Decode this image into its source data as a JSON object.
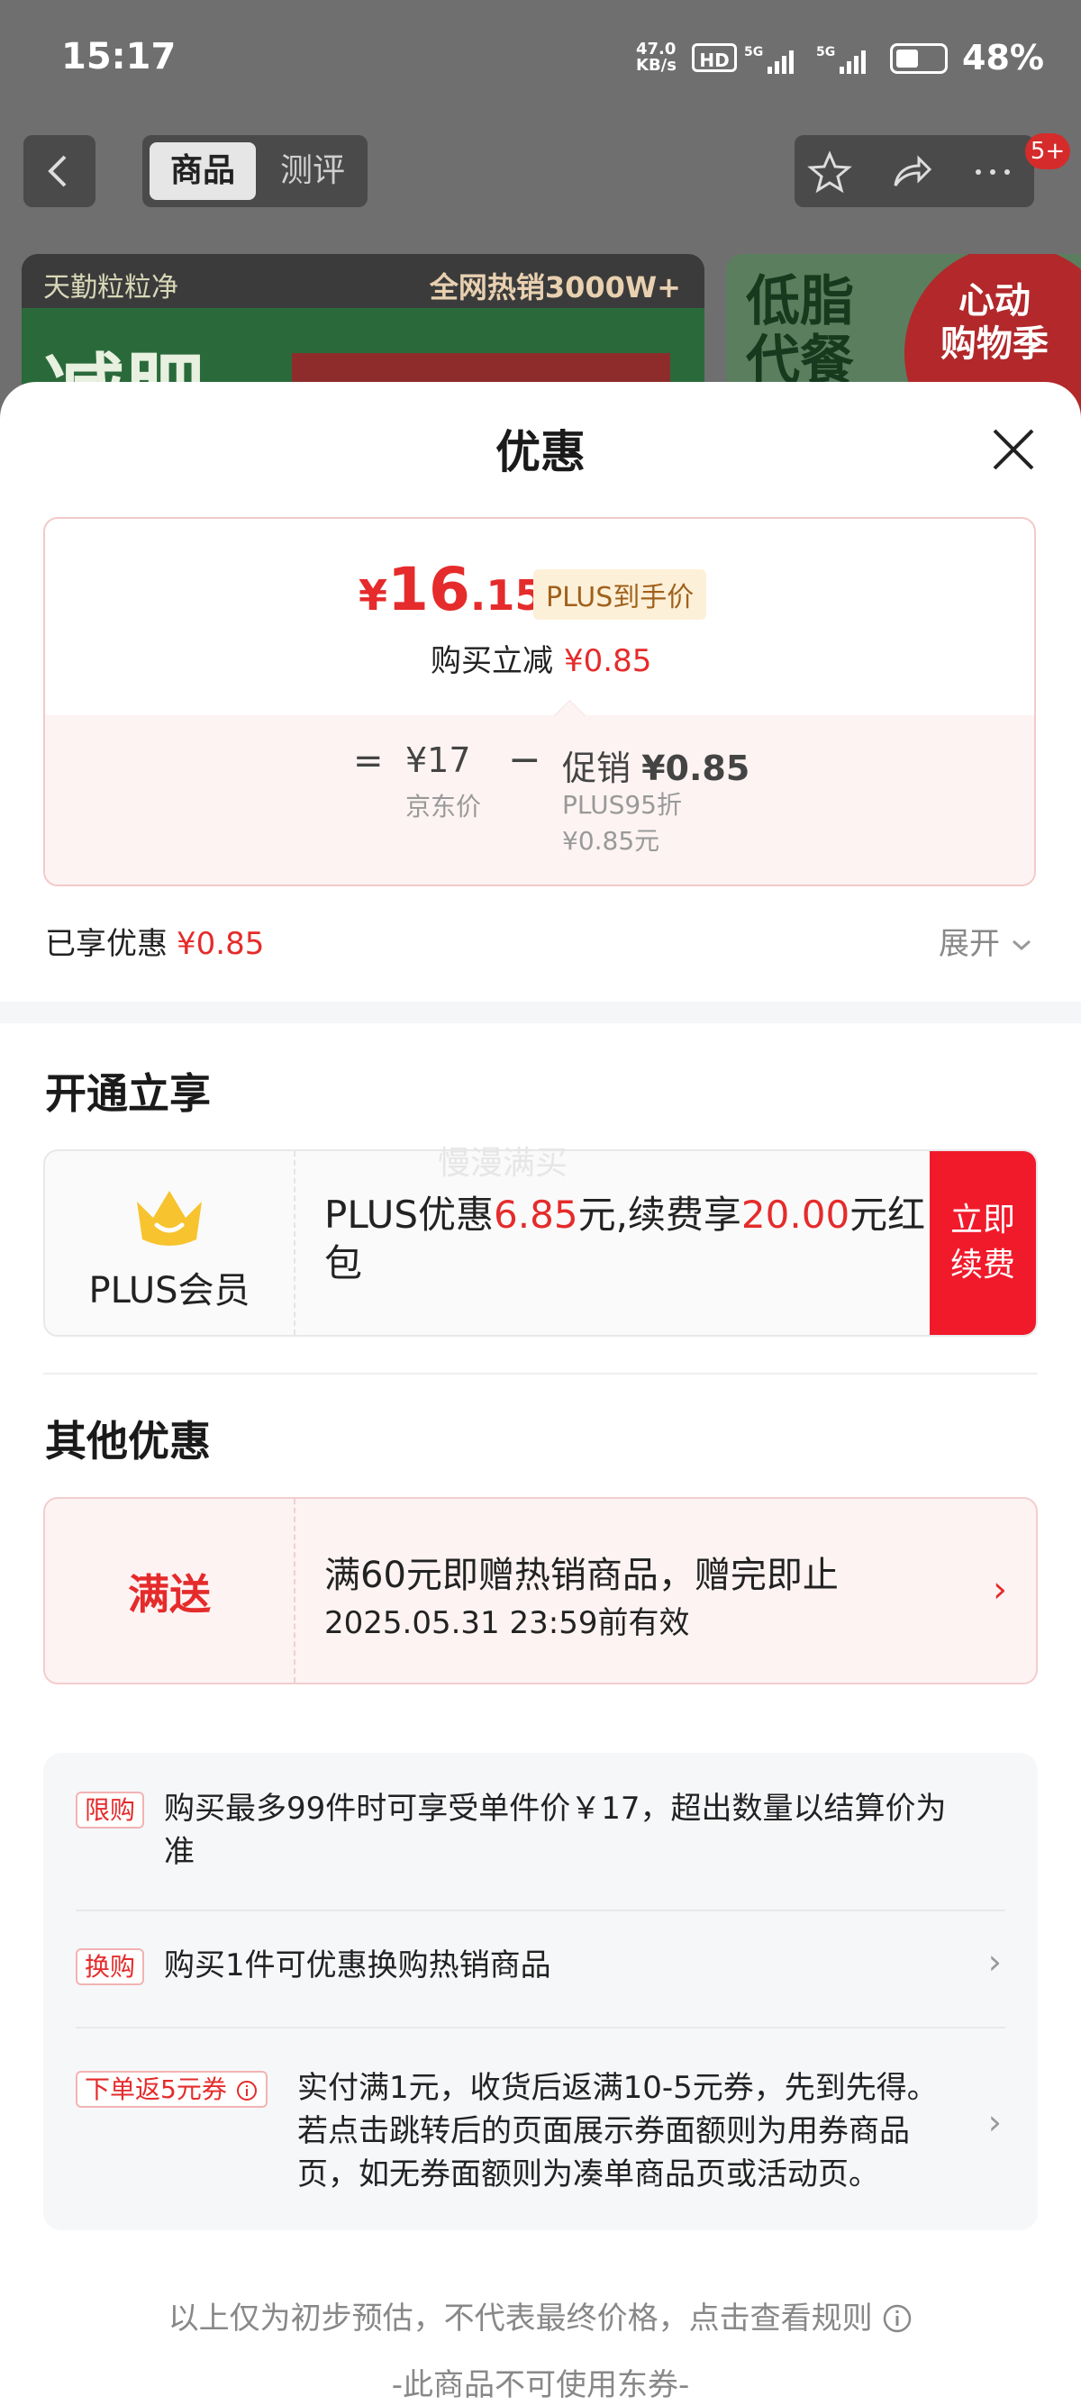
{
  "status_bar": {
    "time": "15:17",
    "net_speed": "47.0\nKB/s",
    "hd": "HD",
    "network": "5G",
    "battery": "48%"
  },
  "nav": {
    "tab_product": "商品",
    "tab_review": "测评",
    "badge": "5+"
  },
  "banner": {
    "brand": "天勤粒粒净",
    "sales": "全网热销3000W+",
    "left_big": "减肥",
    "right_title": "低脂\n代餐",
    "right_badge": "心动\n购物季"
  },
  "sheet": {
    "title": "优惠"
  },
  "price": {
    "currency": "¥",
    "int": "16",
    "dec": ".15",
    "plus_tag": "PLUS到手价",
    "reduce_label": "购买立减",
    "reduce_value": "¥0.85",
    "eq": "=",
    "jd_price": "¥17",
    "jd_label": "京东价",
    "minus": "−",
    "promo_label": "促销",
    "promo_value": "¥0.85",
    "promo_detail1": "PLUS95折",
    "promo_detail2": "¥0.85元"
  },
  "enjoyed": {
    "label": "已享优惠",
    "value": "¥0.85",
    "expand": "展开"
  },
  "open_section": {
    "title": "开通立享",
    "watermark": "慢漫满买",
    "member_label": "PLUS会员",
    "text_a": "PLUS优惠",
    "amount1": "6.85",
    "text_b": "元,续费享",
    "amount2": "20.00",
    "text_c": "元红包",
    "renew_button": "立即\n续费"
  },
  "other_section": {
    "title": "其他优惠",
    "gift_tag": "满送",
    "gift_line1": "满60元即赠热销商品，赠完即止",
    "gift_line2": "2025.05.31 23:59前有效"
  },
  "info_items": [
    {
      "tag": "限购",
      "text": "购买最多99件时可享受单件价￥17，超出数量以结算价为准"
    },
    {
      "tag": "换购",
      "text": "购买1件可优惠换购热销商品"
    },
    {
      "tag": "下单返5元券",
      "text": "实付满1元，收货后返满10-5元券，先到先得。若点击跳转后的页面展示券面额则为用券商品页，如无券面额则为凑单商品页或活动页。"
    }
  ],
  "footer": {
    "estimate": "以上仅为初步预估，不代表最终价格，点击查看规则",
    "no_coupon": "-此商品不可使用东券-"
  },
  "colors": {
    "accent_red": "#e52b2b",
    "renew_red": "#f01a2b",
    "plus_gold": "#f7c32e"
  }
}
